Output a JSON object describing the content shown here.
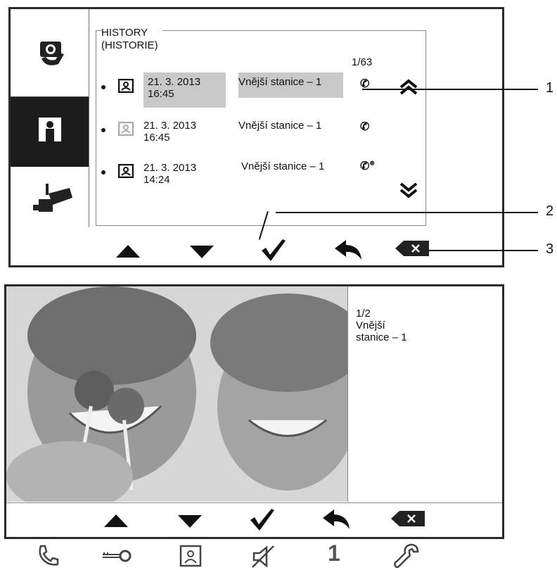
{
  "history_screen": {
    "title_line1": "HISTORY",
    "title_line2": "(HISTORIE)",
    "page_counter": "1/63",
    "entries": [
      {
        "date": "21. 3. 2013",
        "time": "16:45",
        "source": "Vnější stanice – 1",
        "call_icon": "incoming-call-icon",
        "highlighted": true
      },
      {
        "date": "21. 3. 2013",
        "time": "16:45",
        "source": "Vnější stanice – 1",
        "call_icon": "incoming-call-icon",
        "highlighted": false
      },
      {
        "date": "21. 3. 2013",
        "time": "14:24",
        "source": "Vnější stanice – 1",
        "call_icon": "missed-call-icon",
        "highlighted": false
      }
    ],
    "sidebar_icons": [
      "message-icon",
      "person-icon",
      "camera-icon"
    ],
    "toolbar_icons": [
      "up-arrow-icon",
      "down-arrow-icon",
      "check-icon",
      "back-icon",
      "delete-icon"
    ]
  },
  "callouts": [
    "1",
    "2",
    "3"
  ],
  "photo_screen": {
    "counter": "1/2",
    "source_line1": "Vnější",
    "source_line2": "stanice – 1",
    "toolbar_icons": [
      "up-arrow-icon",
      "down-arrow-icon",
      "check-icon",
      "back-icon",
      "delete-icon"
    ]
  },
  "bottom_bar": {
    "icons": [
      "phone-icon",
      "key-icon",
      "person-card-icon",
      "mute-icon",
      "number-one-icon",
      "wrench-icon"
    ],
    "number_label": "1"
  }
}
